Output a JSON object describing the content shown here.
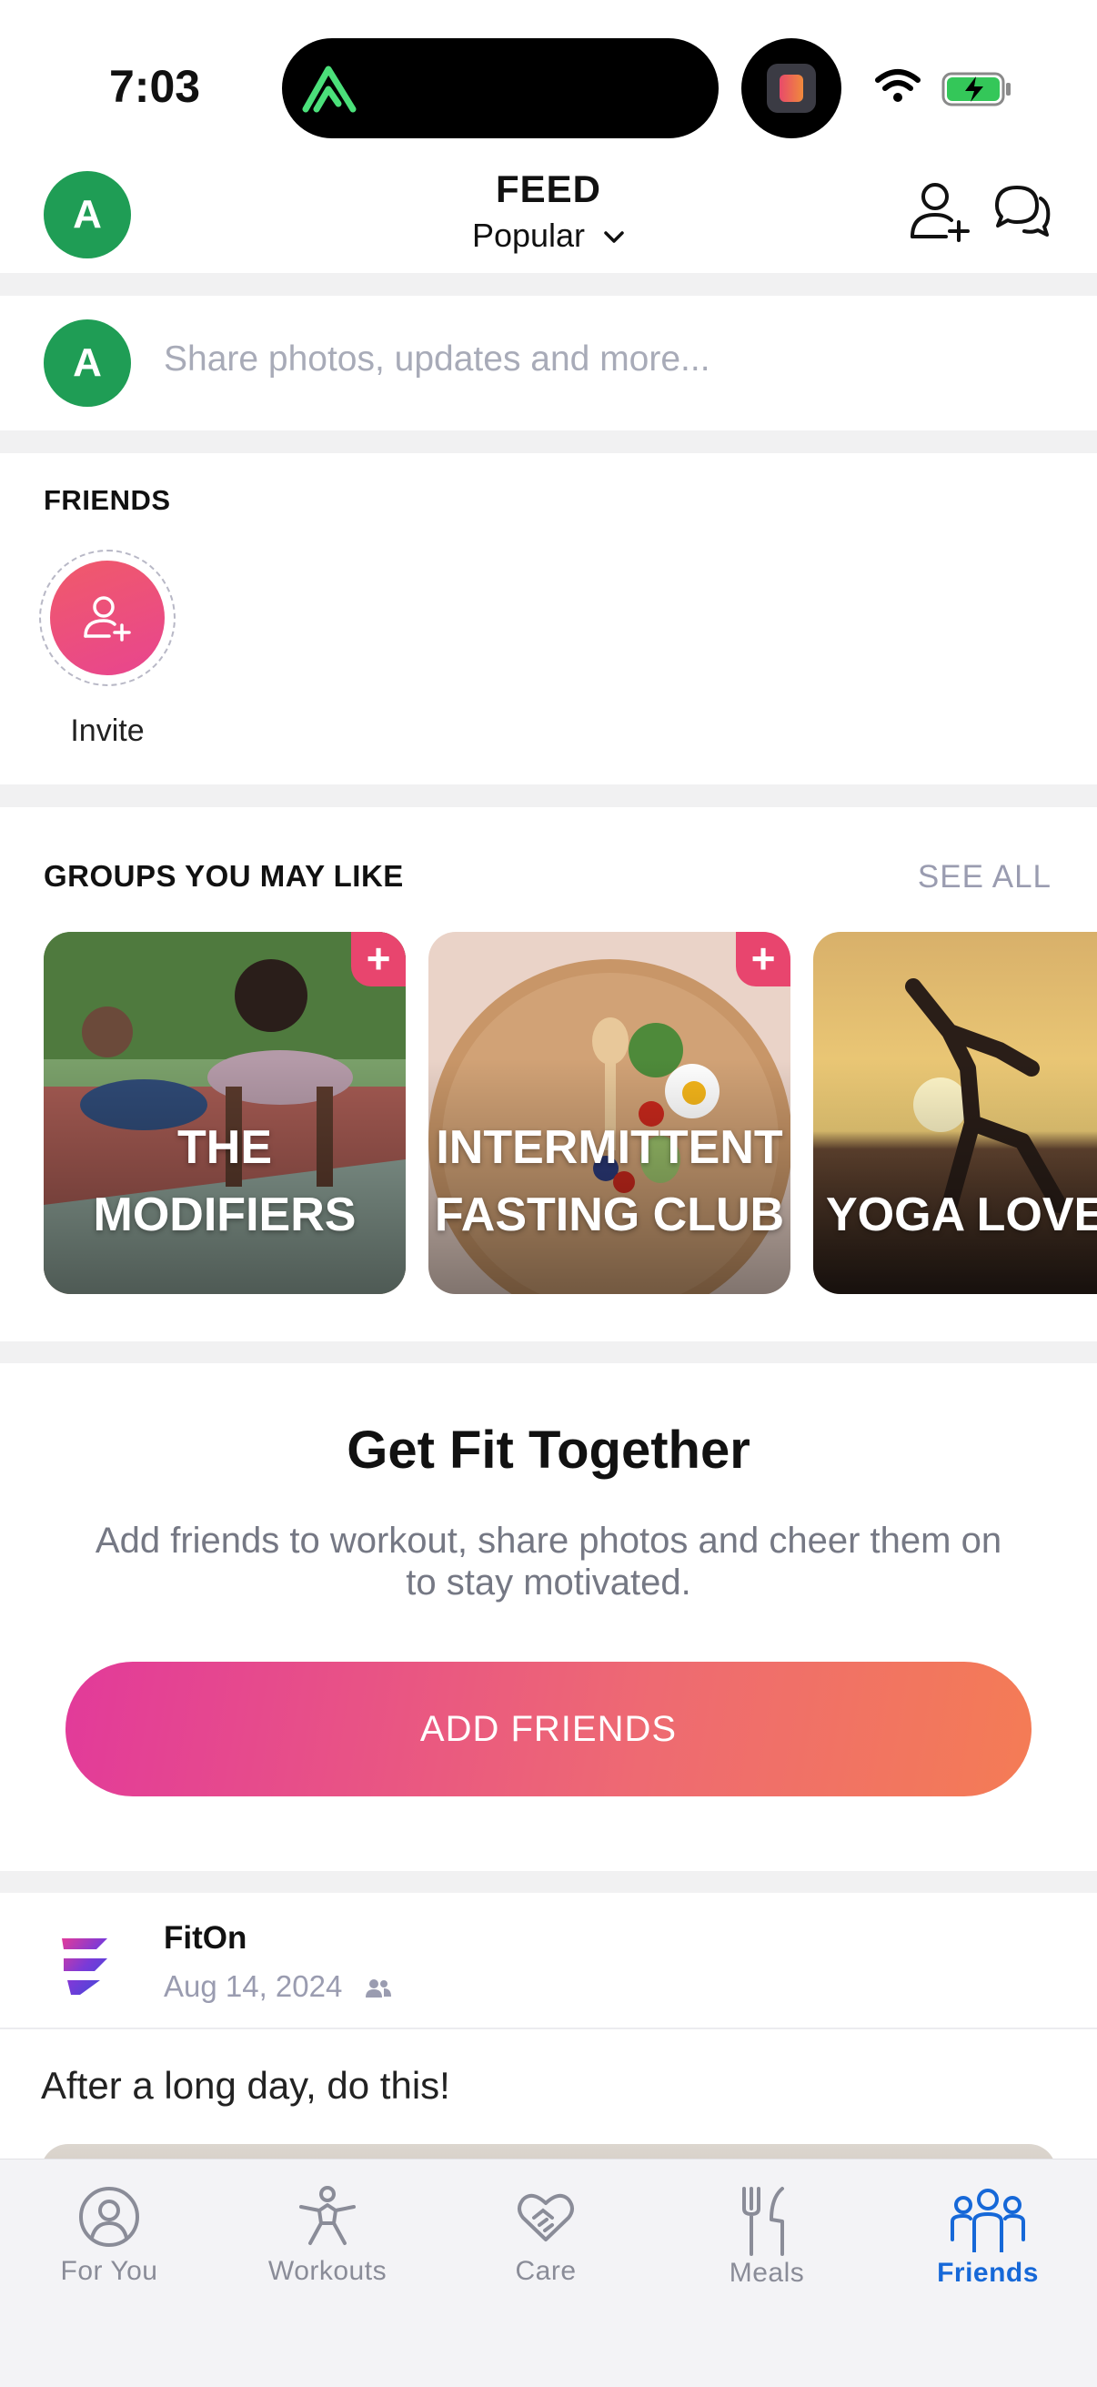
{
  "status_bar": {
    "time": "7:03"
  },
  "header": {
    "avatar_initial": "A",
    "title": "FEED",
    "filter": "Popular"
  },
  "composer": {
    "avatar_initial": "A",
    "placeholder": "Share photos, updates and more..."
  },
  "friends": {
    "heading": "FRIENDS",
    "invite_label": "Invite"
  },
  "groups": {
    "heading": "GROUPS YOU MAY LIKE",
    "see_all": "SEE ALL",
    "cards": [
      {
        "title": "THE\nMODIFIERS"
      },
      {
        "title": "INTERMITTENT\nFASTING CLUB"
      },
      {
        "title": "YOGA LOVERS"
      }
    ]
  },
  "promo": {
    "title": "Get Fit Together",
    "description": "Add friends to workout, share photos and cheer them on to stay motivated.",
    "button": "ADD FRIENDS"
  },
  "post": {
    "author": "FitOn",
    "date": "Aug 14, 2024",
    "text": "After a long day, do this!"
  },
  "tabbar": {
    "items": [
      {
        "label": "For You",
        "icon": "person-circle-icon"
      },
      {
        "label": "Workouts",
        "icon": "figure-icon"
      },
      {
        "label": "Care",
        "icon": "handshake-heart-icon"
      },
      {
        "label": "Meals",
        "icon": "fork-knife-icon"
      },
      {
        "label": "Friends",
        "icon": "group-icon",
        "active": true
      }
    ]
  },
  "colors": {
    "accent_blue": "#1668d8",
    "avatar_green": "#1f9d55",
    "brand_pink": "#e8456e",
    "button_gradient_start": "#e23a9a",
    "button_gradient_end": "#f47c55"
  }
}
